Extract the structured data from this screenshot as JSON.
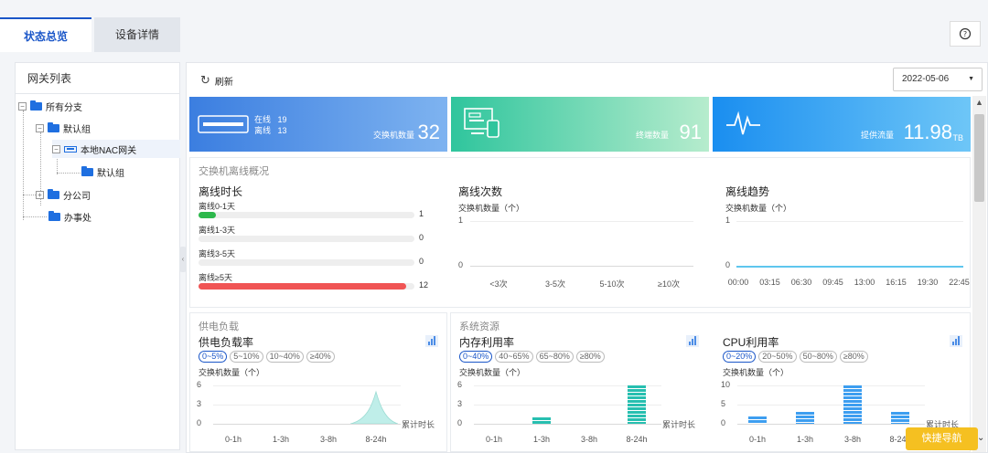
{
  "tabs": {
    "overview": "状态总览",
    "details": "设备详情"
  },
  "help_icon": "help-circle-icon",
  "left_panel": {
    "title": "网关列表",
    "tree": [
      "所有分支",
      "默认组",
      "本地NAC网关",
      "默认组",
      "分公司",
      "办事处"
    ]
  },
  "toolbar": {
    "refresh": "刷新",
    "date": "2022-05-06"
  },
  "cards": {
    "switch": {
      "online_label": "在线",
      "online_value": "19",
      "offline_label": "离线",
      "offline_value": "13",
      "caption": "交换机数量",
      "value": "32"
    },
    "terminal": {
      "caption": "终端数量",
      "value": "91"
    },
    "traffic": {
      "caption": "提供流量",
      "value": "11.98",
      "unit": "TB"
    }
  },
  "offline_section": {
    "title": "交换机离线概况",
    "duration": {
      "title": "离线时长",
      "items": [
        {
          "label": "离线0-1天",
          "value": 1,
          "color": "#2db84c"
        },
        {
          "label": "离线1-3天",
          "value": 0,
          "color": "#2db84c"
        },
        {
          "label": "离线3-5天",
          "value": 0,
          "color": "#2db84c"
        },
        {
          "label": "离线≥5天",
          "value": 12,
          "color": "#f05454"
        }
      ],
      "max": 12
    },
    "count": {
      "title": "离线次数",
      "ylabel": "交换机数量（个）",
      "yticks": [
        "1",
        "0"
      ],
      "xticks": [
        "<3次",
        "3-5次",
        "5-10次",
        "≥10次"
      ]
    },
    "trend": {
      "title": "离线趋势",
      "ylabel": "交换机数量（个）",
      "yticks": [
        "1",
        "0"
      ],
      "xticks": [
        "00:00",
        "03:15",
        "06:30",
        "09:45",
        "13:00",
        "16:15",
        "19:30",
        "22:45"
      ]
    }
  },
  "power_section": {
    "title": "供电负载",
    "rate": {
      "title": "供电负载率",
      "pills": [
        "0~5%",
        "5~10%",
        "10~40%",
        "≥40%"
      ],
      "ylabel": "交换机数量（个）",
      "yticks": [
        "6",
        "3",
        "0"
      ],
      "xticks": [
        "0-1h",
        "1-3h",
        "3-8h",
        "8-24h"
      ],
      "cumulative_label": "累计时长"
    }
  },
  "system_section": {
    "title": "系统资源",
    "memory": {
      "title": "内存利用率",
      "pills": [
        "0~40%",
        "40~65%",
        "65~80%",
        "≥80%"
      ],
      "ylabel": "交换机数量（个）",
      "yticks": [
        "6",
        "3",
        "0"
      ],
      "xticks": [
        "0-1h",
        "1-3h",
        "3-8h",
        "8-24h"
      ],
      "cumulative_label": "累计时长",
      "color": "#27bfb0"
    },
    "cpu": {
      "title": "CPU利用率",
      "pills": [
        "0~20%",
        "20~50%",
        "50~80%",
        "≥80%"
      ],
      "ylabel": "交换机数量（个）",
      "yticks": [
        "10",
        "5",
        "0"
      ],
      "xticks": [
        "0-1h",
        "1-3h",
        "3-8h",
        "8-24h"
      ],
      "cumulative_label": "累计时长",
      "color": "#3d9ef0"
    }
  },
  "quick_nav": "快捷导航",
  "chart_data": [
    {
      "type": "bar",
      "title": "离线时长",
      "categories": [
        "离线0-1天",
        "离线1-3天",
        "离线3-5天",
        "离线≥5天"
      ],
      "values": [
        1,
        0,
        0,
        12
      ]
    },
    {
      "type": "bar",
      "title": "离线次数",
      "ylabel": "交换机数量（个）",
      "categories": [
        "<3次",
        "3-5次",
        "5-10次",
        "≥10次"
      ],
      "values": [
        0,
        0,
        0,
        0
      ],
      "ylim": [
        0,
        1
      ]
    },
    {
      "type": "line",
      "title": "离线趋势",
      "ylabel": "交换机数量（个）",
      "x": [
        "00:00",
        "03:15",
        "06:30",
        "09:45",
        "13:00",
        "16:15",
        "19:30",
        "22:45"
      ],
      "values": [
        0,
        0,
        0,
        0,
        0,
        0,
        0,
        0
      ],
      "ylim": [
        0,
        1
      ]
    },
    {
      "type": "area",
      "title": "供电负载率",
      "ylabel": "交换机数量（个）",
      "xlabel": "累计时长",
      "categories": [
        "0-1h",
        "1-3h",
        "3-8h",
        "8-24h"
      ],
      "values": [
        0,
        0,
        0,
        5
      ],
      "ylim": [
        0,
        6
      ]
    },
    {
      "type": "bar",
      "title": "内存利用率",
      "ylabel": "交换机数量（个）",
      "xlabel": "累计时长",
      "categories": [
        "0-1h",
        "1-3h",
        "3-8h",
        "8-24h"
      ],
      "values": [
        0,
        1,
        0,
        6
      ],
      "ylim": [
        0,
        6
      ]
    },
    {
      "type": "bar",
      "title": "CPU利用率",
      "ylabel": "交换机数量（个）",
      "xlabel": "累计时长",
      "categories": [
        "0-1h",
        "1-3h",
        "3-8h",
        "8-24h"
      ],
      "values": [
        2,
        3,
        10,
        3
      ],
      "ylim": [
        0,
        10
      ]
    }
  ]
}
